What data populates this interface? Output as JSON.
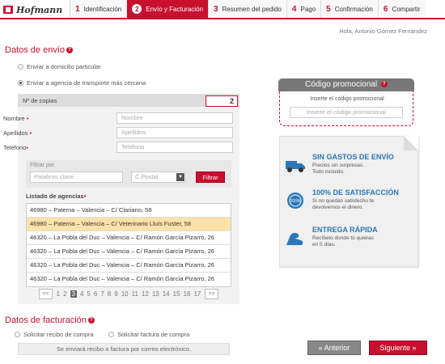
{
  "brand": {
    "name": "Hofmann",
    "accent": "#c8102e"
  },
  "steps": [
    {
      "num": "1",
      "label": "Identificación"
    },
    {
      "num": "2",
      "label": "Envío y Facturación"
    },
    {
      "num": "3",
      "label": "Resumen del pedido"
    },
    {
      "num": "4",
      "label": "Pago"
    },
    {
      "num": "5",
      "label": "Confirmación"
    },
    {
      "num": "6",
      "label": "Compartir"
    }
  ],
  "greeting": "Hola, Antonio Gómez Fernández",
  "shipping": {
    "title": "Datos de envío",
    "option_home": "Enviar a domicilio particular",
    "option_agency": "Enviar a agencia de transporte más cercana",
    "copies_label": "Nº de copias",
    "copies_value": "2",
    "name_label": "Nombre",
    "name_placeholder": "Nombre",
    "surname_label": "Apellidos",
    "surname_placeholder": "Apellidos",
    "phone_label": "Teléfono",
    "phone_placeholder": "Teléfono",
    "filter_title": "Filtrar por",
    "keywords_placeholder": "Palabras clave",
    "postal_placeholder": "C.Postal",
    "filter_button": "Filtrar",
    "agencies_title": "Listado de agencias",
    "agencies": [
      "46980 – Paterna – Valencia – C/ Clariano, 58",
      "46980 – Paterna – Valencia – C/ Veterinario Lluís Fuster, 58",
      "46320 – La Pobla del Duc – Valencia – C/ Ramón García Pizarro, 26",
      "46320 – La Pobla del Duc – Valencia – C/ Ramón García Pizarro, 26",
      "46320 – La Pobla del Duc – Valencia – C/ Ramón García Pizarro, 26",
      "46320 – La Pobla del Duc – Valencia – C/ Ramón García Pizarro, 26"
    ],
    "pager": {
      "first": "<<",
      "last": ">>",
      "pages": [
        "1",
        "2",
        "3",
        "4",
        "5",
        "6",
        "7",
        "8",
        "9",
        "10",
        "11",
        "12",
        "13",
        "14",
        "15",
        "16",
        "17"
      ],
      "active": "3"
    }
  },
  "promo": {
    "title": "Código promocional",
    "subtitle": "Inserte el código promocional",
    "placeholder": "Inserte el código promocional"
  },
  "benefits": [
    {
      "icon": "truck-icon",
      "title": "SIN GASTOS DE ENVÍO",
      "desc": "Precios sin sorpresas.\nTodo incluido."
    },
    {
      "icon": "satisfaction-seal-icon",
      "title": "100% DE SATISFACCIÓN",
      "desc": "Si no quedas satisfecho te\ndevolvemos el dinero."
    },
    {
      "icon": "arm-strength-icon",
      "title": "ENTREGA RÁPIDA",
      "desc": "Recíbelo donde tú quieras\nen 5 días."
    }
  ],
  "billing": {
    "title": "Datos de facturación",
    "option_receipt": "Solicitar recibo de compra",
    "option_invoice": "Solicitar factura de compra",
    "note": "Se enviará recibo o factura por correo electrónico."
  },
  "nav": {
    "prev": "Anterior",
    "next": "Siguiente"
  }
}
